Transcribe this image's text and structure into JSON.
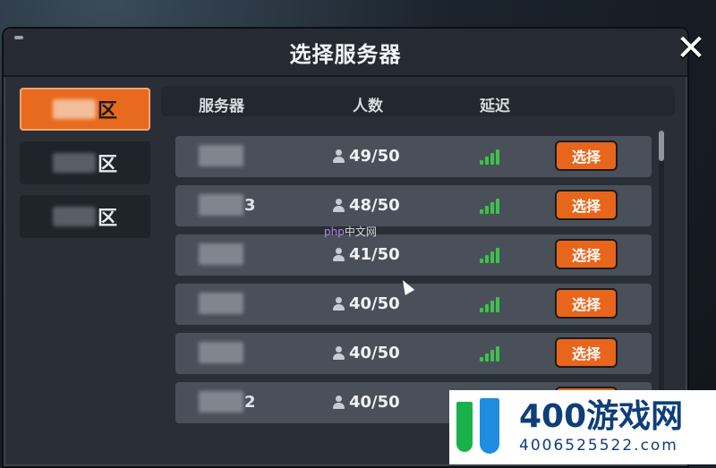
{
  "dialog": {
    "title": "选择服务器",
    "close_label": "✕"
  },
  "regions": [
    {
      "label": "区",
      "active": true
    },
    {
      "label": "区",
      "active": false
    },
    {
      "label": "区",
      "active": false
    }
  ],
  "table": {
    "headers": {
      "server": "服务器",
      "count": "人数",
      "ping": "延迟"
    },
    "rows": [
      {
        "server_suffix": "",
        "count": "49/50",
        "button": "选择"
      },
      {
        "server_suffix": "3",
        "count": "48/50",
        "button": "选择"
      },
      {
        "server_suffix": "",
        "count": "41/50",
        "button": "选择"
      },
      {
        "server_suffix": "",
        "count": "40/50",
        "button": "选择"
      },
      {
        "server_suffix": "",
        "count": "40/50",
        "button": "选择"
      },
      {
        "server_suffix": "2",
        "count": "40/50",
        "button": "选择"
      }
    ]
  },
  "watermarks": {
    "php": "php",
    "php_cn": "中文网",
    "site_big": "400游戏网",
    "site_small": "4006525522.com"
  },
  "colors": {
    "accent": "#e8661c",
    "signal": "#3fc24a",
    "panel": "#2a2f37"
  }
}
